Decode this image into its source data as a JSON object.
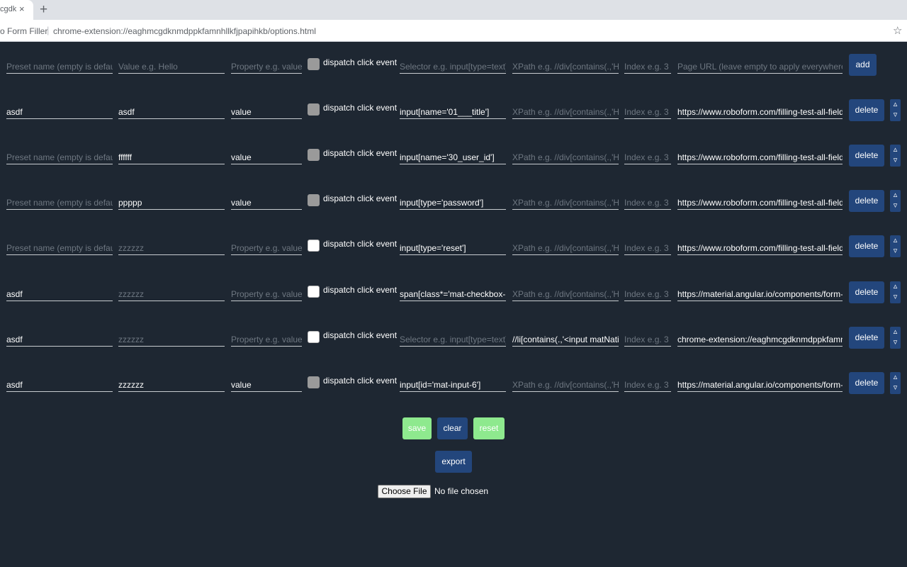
{
  "browser": {
    "tab_title": "cgdk",
    "tab_close": "×",
    "new_tab": "+",
    "site_name": "o Form Filler",
    "separator": "|",
    "url": "chrome-extension://eaghmcgdknmdppkfamnhllkfjpapihkb/options.html",
    "star": "☆"
  },
  "placeholders": {
    "preset": "Preset name (empty is default)",
    "value": "Value e.g. Hello",
    "property": "Property e.g. value",
    "selector": "Selector e.g. input[type=text]",
    "xpath": "XPath e.g. //div[contains(.,'Hello')]",
    "index": "Index e.g. 3",
    "url": "Page URL (leave empty to apply everywhere)"
  },
  "labels": {
    "dispatch": "dispatch click event",
    "add": "add",
    "delete": "delete",
    "up": "▵",
    "down": "▿"
  },
  "rows": [
    {
      "preset": "asdf",
      "value": "asdf",
      "property": "value",
      "checkbox": "grey",
      "selector": "input[name='01___title']",
      "xpath": "",
      "index": "",
      "url": "https://www.roboform.com/filling-test-all-fields"
    },
    {
      "preset": "",
      "value": "ffffff",
      "property": "value",
      "checkbox": "grey",
      "selector": "input[name='30_user_id']",
      "xpath": "",
      "index": "",
      "url": "https://www.roboform.com/filling-test-all-fields"
    },
    {
      "preset": "",
      "value": "ppppp",
      "property": "value",
      "checkbox": "grey",
      "selector": "input[type='password']",
      "xpath": "",
      "index": "",
      "url": "https://www.roboform.com/filling-test-all-fields"
    },
    {
      "preset": "",
      "value": "",
      "property": "",
      "checkbox": "white",
      "selector": "input[type='reset']",
      "xpath": "",
      "index": "",
      "url": "https://www.roboform.com/filling-test-all-fields"
    },
    {
      "preset": "asdf",
      "value": "",
      "property": "",
      "checkbox": "white",
      "selector": "span[class*='mat-checkbox-label']",
      "xpath": "",
      "index": "",
      "url": "https://material.angular.io/components/form-field"
    },
    {
      "preset": "asdf",
      "value": "",
      "property": "",
      "checkbox": "white",
      "selector": "",
      "xpath": "//li[contains(.,'<input matNativeControl')]",
      "index": "",
      "url": "chrome-extension://eaghmcgdknmdppkfamnhllkfjpapihkb"
    },
    {
      "preset": "asdf",
      "value": "zzzzzz",
      "property": "value",
      "checkbox": "grey",
      "selector": "input[id='mat-input-6']",
      "xpath": "",
      "index": "",
      "url": "https://material.angular.io/components/form-field"
    }
  ],
  "row_placeholders": {
    "value_zz": "zzzzzz"
  },
  "buttons": {
    "save": "save",
    "clear": "clear",
    "reset": "reset",
    "export": "export"
  },
  "file": {
    "button": "Choose File",
    "status": "No file chosen"
  }
}
